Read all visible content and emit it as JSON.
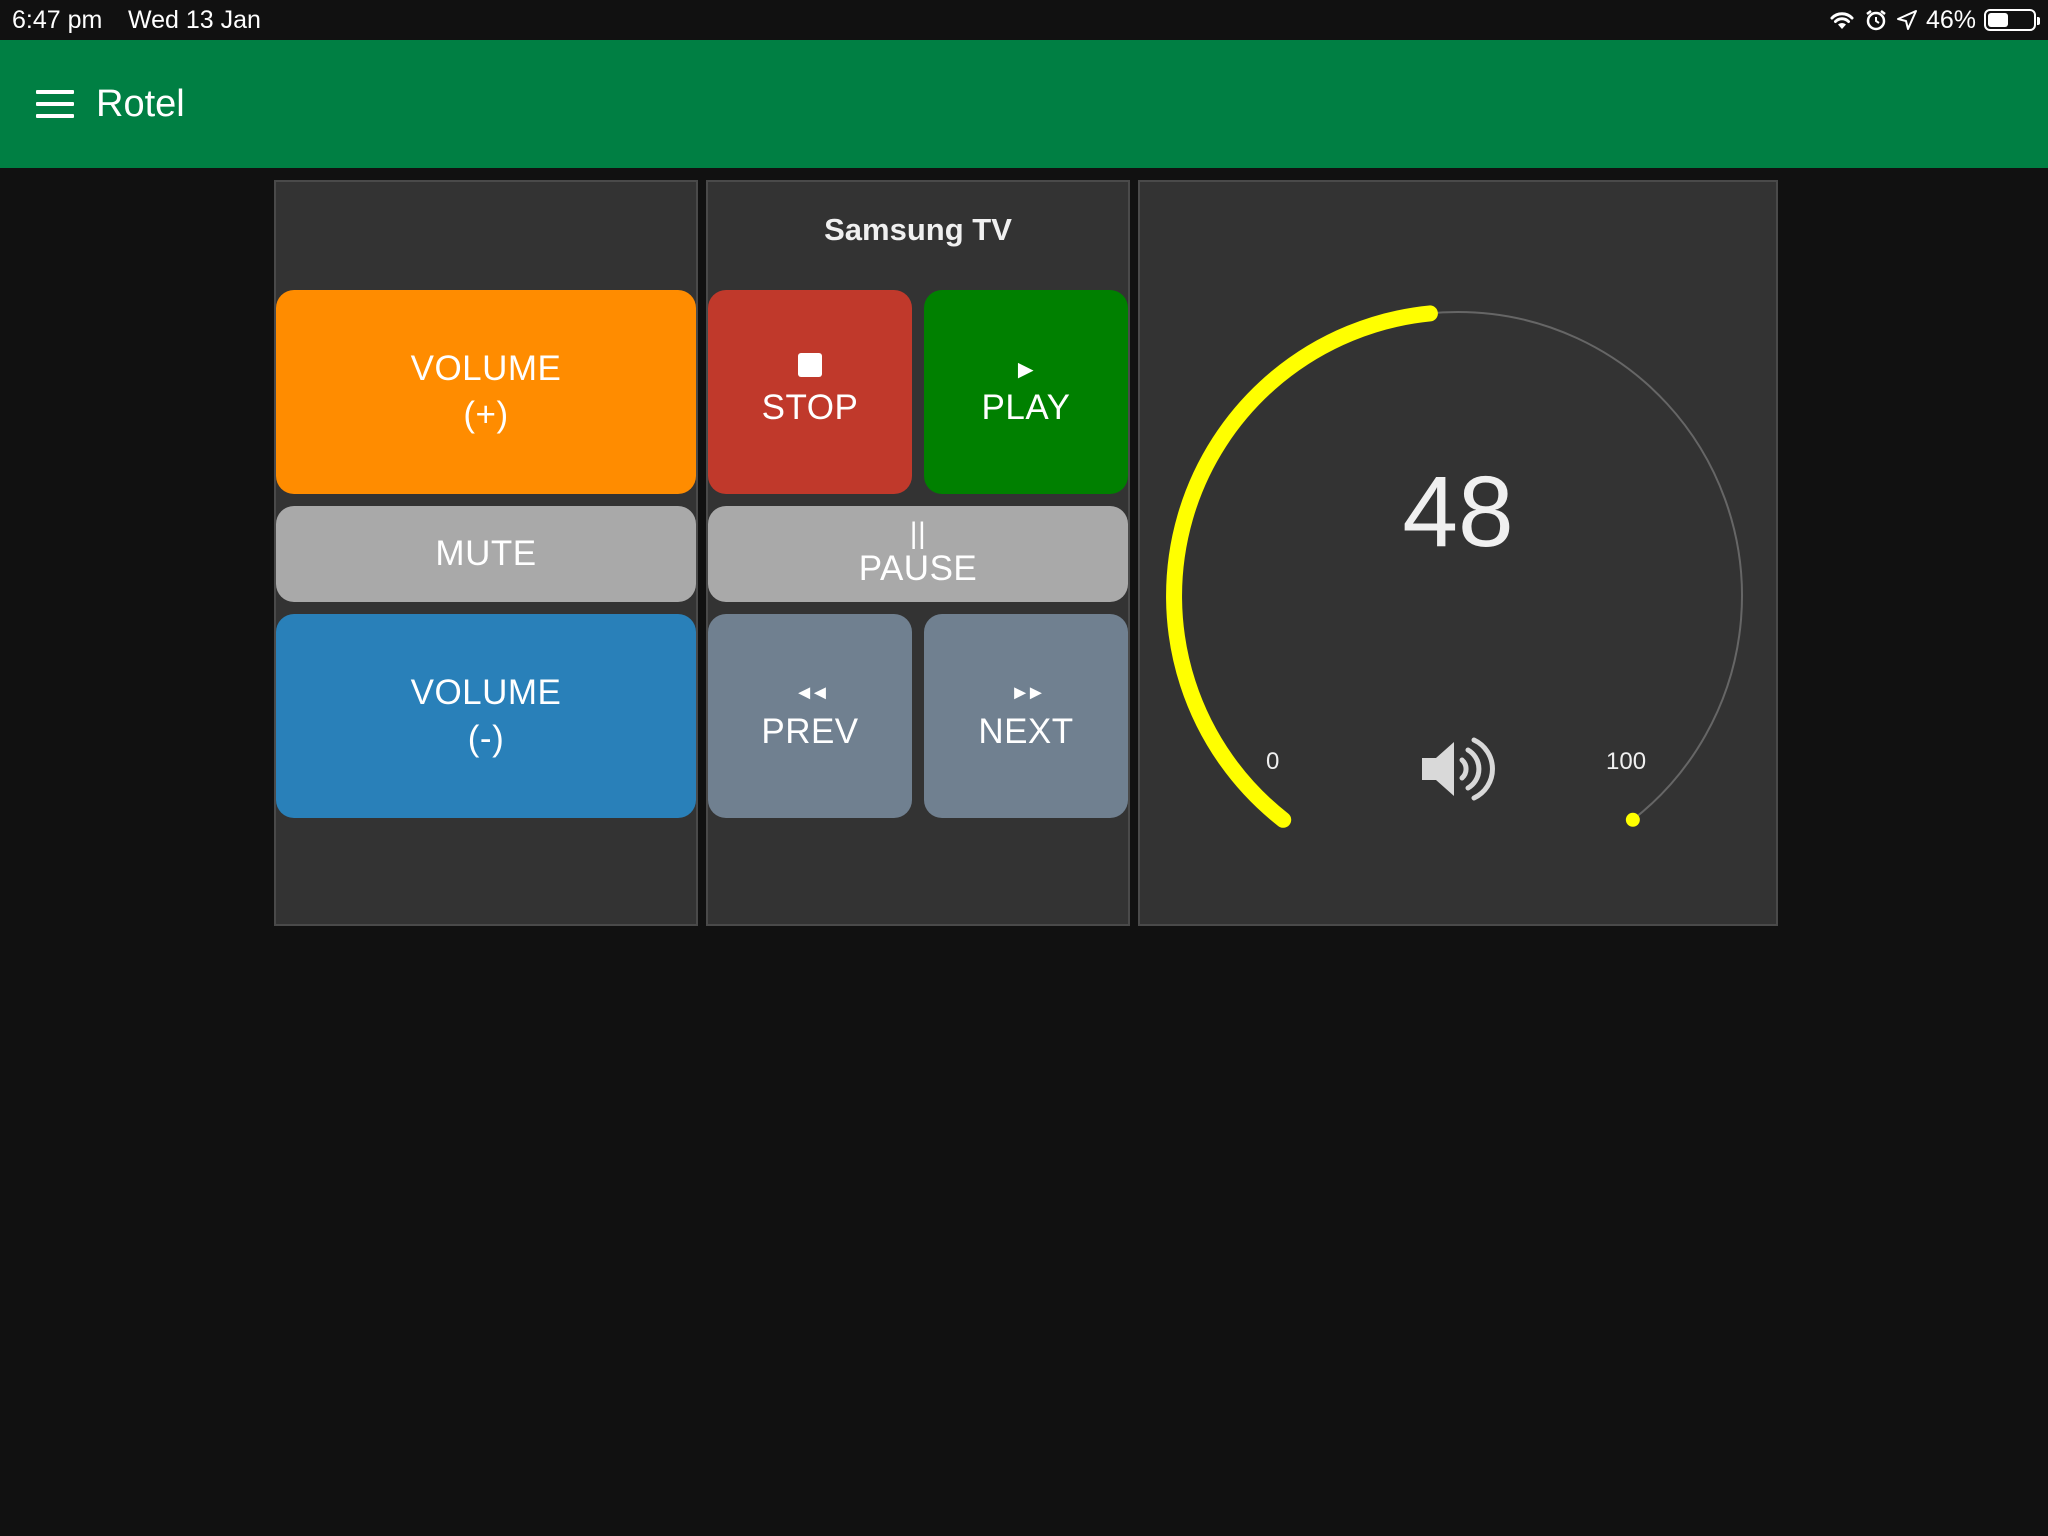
{
  "status_bar": {
    "time": "6:47 pm",
    "date": "Wed 13 Jan",
    "battery_percent": "46%",
    "battery_level": 0.46,
    "icons": [
      "wifi-icon",
      "alarm-icon",
      "location-arrow-icon",
      "battery-icon"
    ]
  },
  "app_bar": {
    "title": "Rotel",
    "menu_icon": "hamburger-menu-icon",
    "background_color": "#007f43"
  },
  "volume_card": {
    "volume_up": {
      "line1": "VOLUME",
      "line2": "(+)",
      "color": "#ff8c00"
    },
    "mute": {
      "label": "MUTE",
      "color": "#a9a9a9"
    },
    "volume_down": {
      "line1": "VOLUME",
      "line2": "(-)",
      "color": "#2980b9"
    }
  },
  "tv_card": {
    "title": "Samsung TV",
    "stop": {
      "glyph": "stop-square-icon",
      "label": "STOP",
      "color": "#c0392b"
    },
    "play": {
      "glyph": "►",
      "label": "PLAY",
      "color": "#008000"
    },
    "pause": {
      "glyph": "||",
      "label": "PAUSE",
      "color": "#a9a9a9"
    },
    "prev": {
      "glyph": "◄◄",
      "label": "PREV",
      "color": "#708090"
    },
    "next": {
      "glyph": "►►",
      "label": "NEXT",
      "color": "#708090"
    }
  },
  "gauge": {
    "value": "48",
    "value_number": 48,
    "min_label": "0",
    "max_label": "100",
    "min": 0,
    "max": 100,
    "fill_color": "#ffff00",
    "icon": "speaker-volume-icon"
  }
}
